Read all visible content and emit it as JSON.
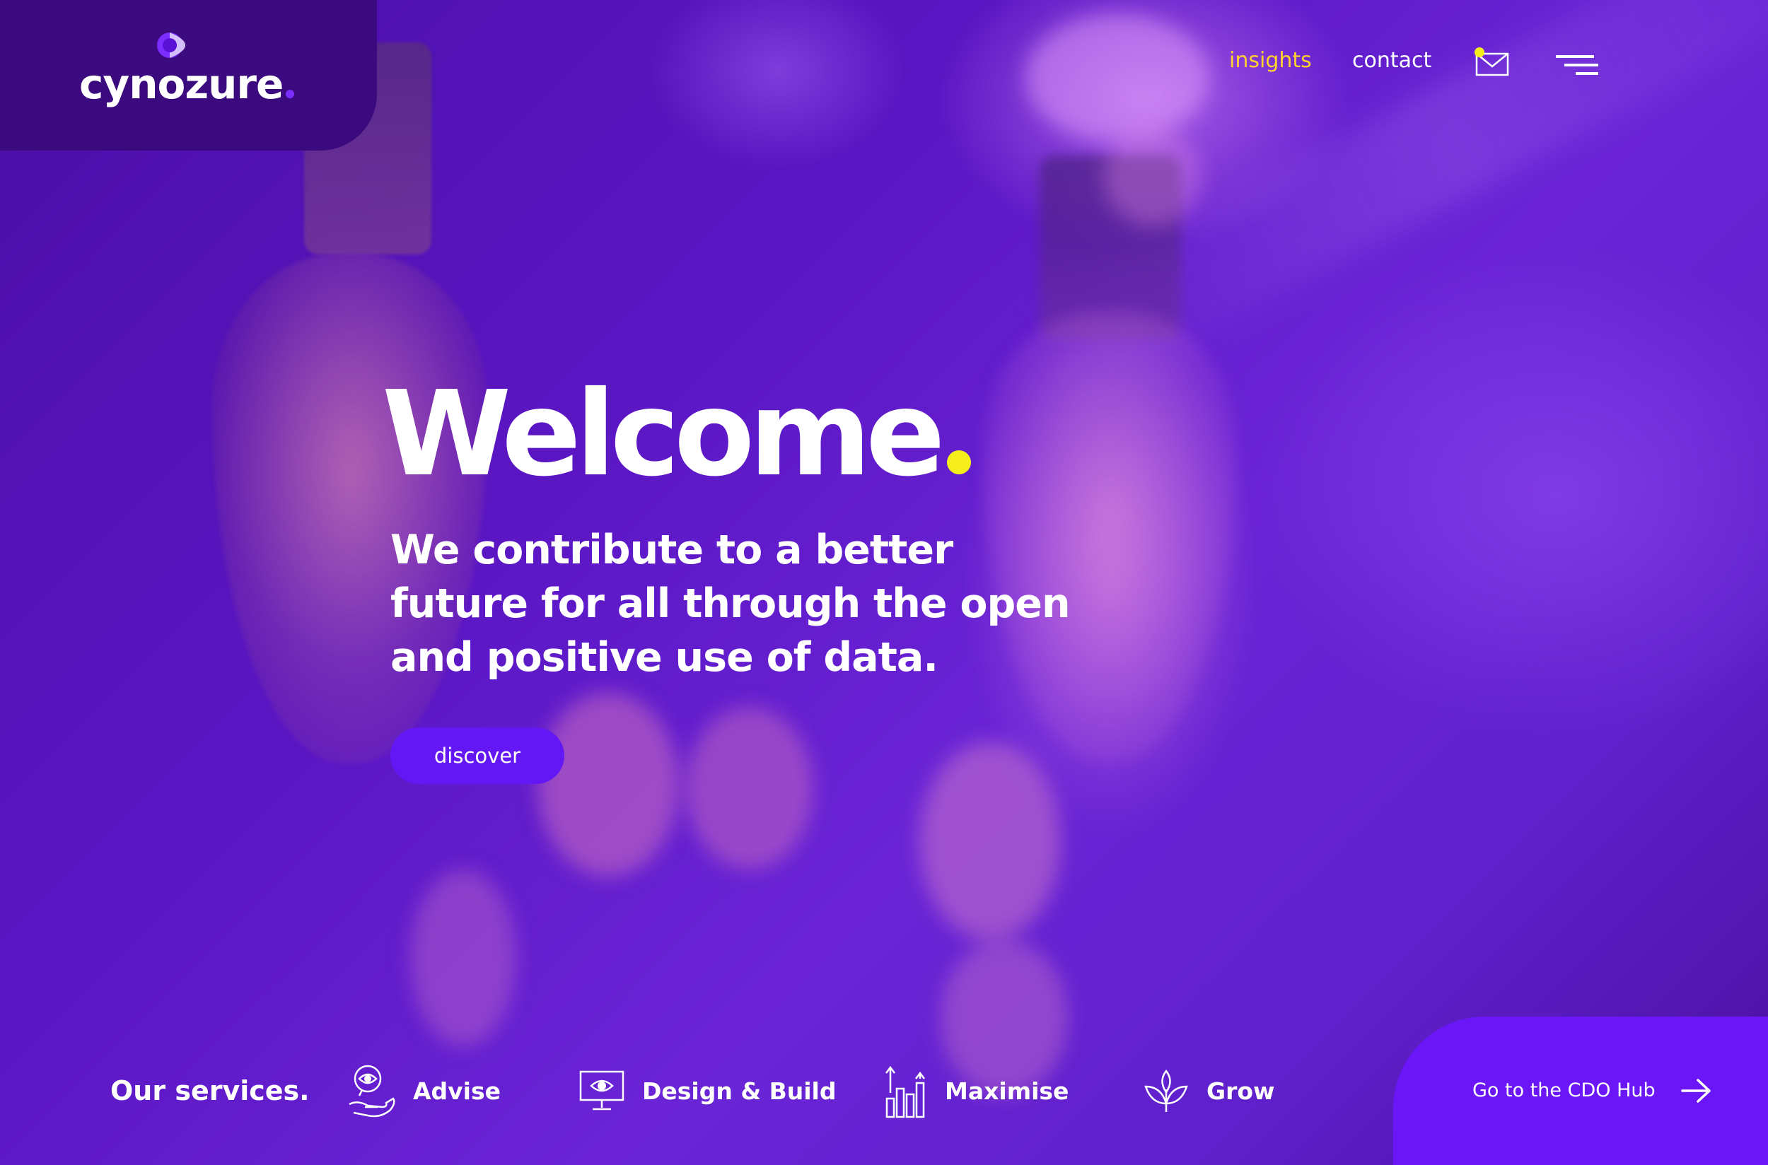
{
  "brand": {
    "name": "cynozure",
    "accent_color": "#7b2cff",
    "highlight_color": "#f5ee1c",
    "nav_active_color": "#ffd22e",
    "header_bg": "#3b0a7e"
  },
  "nav": {
    "links": [
      {
        "label": "insights",
        "active": true
      },
      {
        "label": "contact",
        "active": false
      }
    ],
    "mail_icon": "envelope-icon",
    "menu_icon": "hamburger-menu-icon"
  },
  "hero": {
    "title": "Welcome",
    "subtitle": "We contribute to a better future for all through the open and positive use of data.",
    "cta_label": "discover"
  },
  "services": {
    "title": "Our services.",
    "items": [
      {
        "label": "Advise",
        "icon": "eye-hand-icon"
      },
      {
        "label": "Design & Build",
        "icon": "monitor-eye-icon"
      },
      {
        "label": "Maximise",
        "icon": "growth-bars-icon"
      },
      {
        "label": "Grow",
        "icon": "leaf-icon"
      }
    ]
  },
  "cdo_hub": {
    "label": "Go to the CDO Hub",
    "icon": "arrow-right-icon"
  }
}
